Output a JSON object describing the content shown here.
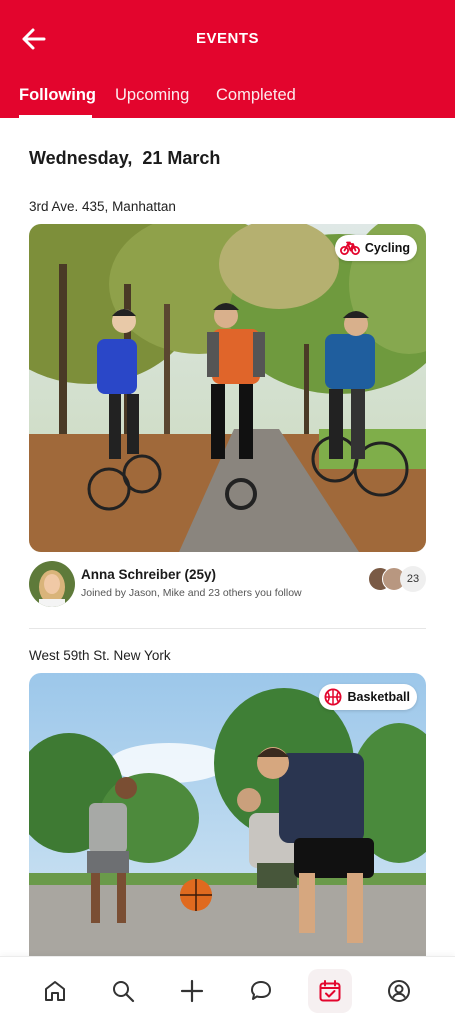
{
  "header": {
    "title": "EVENTS",
    "back_icon": "arrow-left-icon",
    "background": "#e3052d"
  },
  "tabs": [
    {
      "label": "Following",
      "active": true
    },
    {
      "label": "Upcoming",
      "active": false
    },
    {
      "label": "Completed",
      "active": false
    }
  ],
  "date_heading": "Wednesday,  21 March",
  "events": [
    {
      "address": "3rd Ave. 435, Manhattan",
      "tag": {
        "label": "Cycling",
        "icon": "bicycle-icon"
      },
      "host": {
        "name": "Anna Schreiber (25y)",
        "subtitle": "Joined by Jason, Mike and 23 others you follow"
      },
      "followers_count": "23"
    },
    {
      "address": "West 59th St. New York",
      "tag": {
        "label": "Basketball",
        "icon": "basketball-icon"
      }
    }
  ],
  "bottom_nav": [
    {
      "icon": "home-icon",
      "active": false
    },
    {
      "icon": "search-icon",
      "active": false
    },
    {
      "icon": "plus-icon",
      "active": false
    },
    {
      "icon": "chat-bubble-icon",
      "active": false
    },
    {
      "icon": "calendar-check-icon",
      "active": true
    },
    {
      "icon": "user-circle-icon",
      "active": false
    }
  ],
  "colors": {
    "accent": "#e3052d",
    "text": "#1b1b1b",
    "muted": "#555555"
  }
}
